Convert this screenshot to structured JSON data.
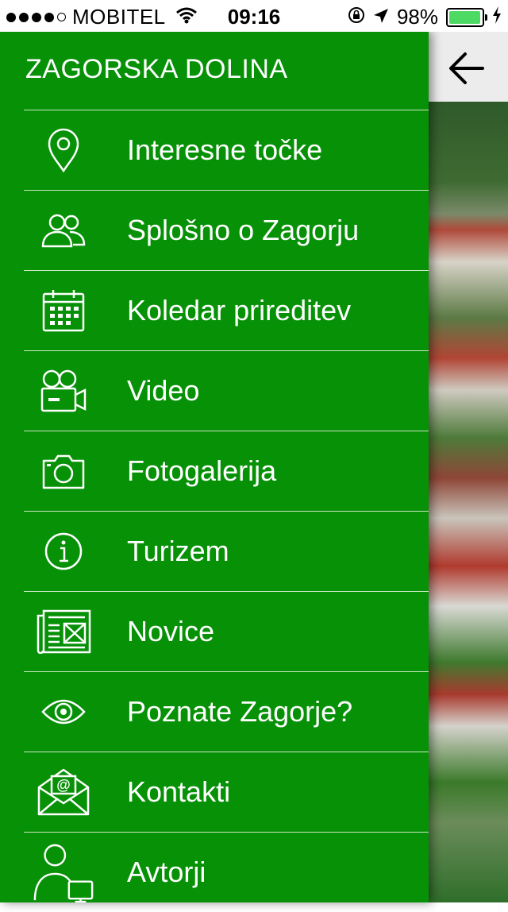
{
  "status_bar": {
    "carrier": "MOBITEL",
    "time": "09:16",
    "battery_percent": "98%",
    "battery_level": 0.98
  },
  "drawer": {
    "title": "ZAGORSKA DOLINA",
    "background_color": "#079107",
    "items": [
      {
        "label": "Interesne točke",
        "icon": "map-pin-icon"
      },
      {
        "label": "Splošno o Zagorju",
        "icon": "people-icon"
      },
      {
        "label": "Koledar prireditev",
        "icon": "calendar-icon"
      },
      {
        "label": "Video",
        "icon": "video-camera-icon"
      },
      {
        "label": "Fotogalerija",
        "icon": "camera-icon"
      },
      {
        "label": "Turizem",
        "icon": "info-icon"
      },
      {
        "label": "Novice",
        "icon": "newspaper-icon"
      },
      {
        "label": "Poznate Zagorje?",
        "icon": "eye-icon"
      },
      {
        "label": "Kontakti",
        "icon": "envelope-icon"
      },
      {
        "label": "Avtorji",
        "icon": "user-computer-icon"
      }
    ]
  },
  "main": {
    "back_icon": "arrow-left-icon"
  }
}
